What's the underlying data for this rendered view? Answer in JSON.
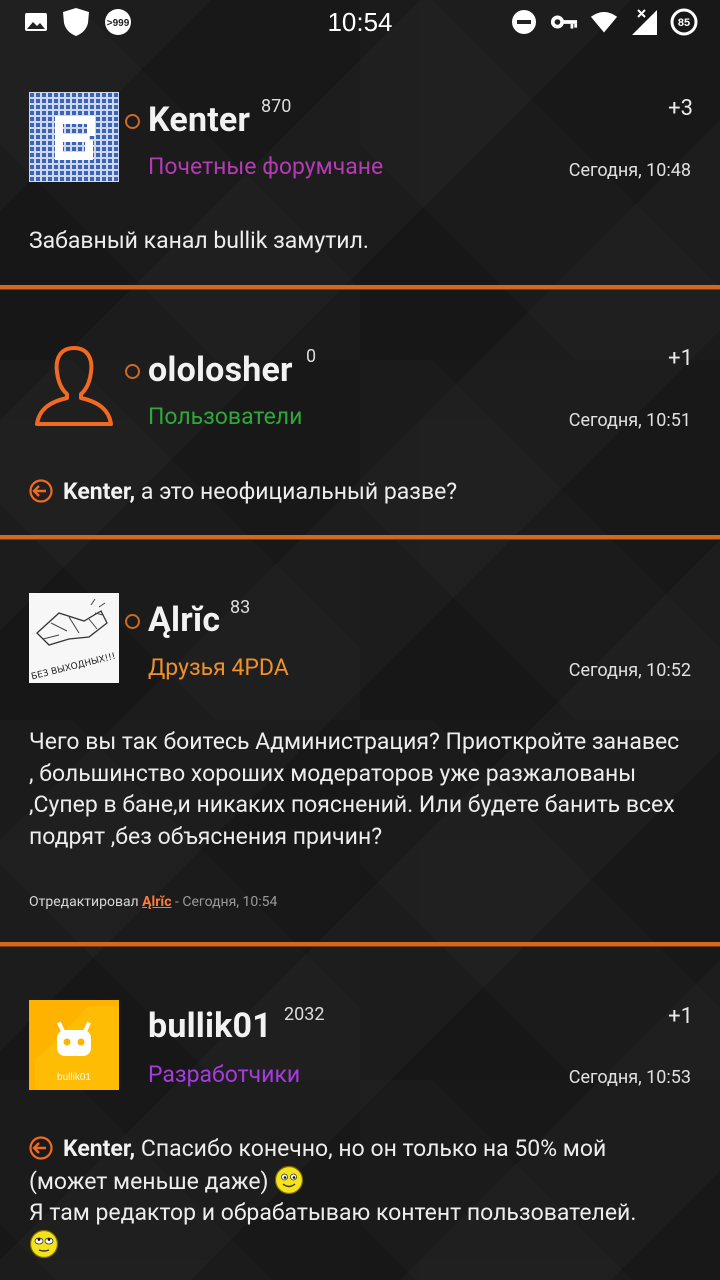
{
  "status_bar": {
    "time": "10:54",
    "notification_badge": ">999",
    "battery": "85",
    "icons": [
      "image-icon",
      "shield-icon",
      "chat-badge-icon",
      "do-not-disturb-icon",
      "key-icon",
      "wifi-icon",
      "signal-icon",
      "battery-icon"
    ]
  },
  "colors": {
    "accent": "#d2691e",
    "group_honored": "#b53bb5",
    "group_users": "#2ea83a",
    "group_friends": "#f0902a",
    "group_developers": "#a63ce0"
  },
  "posts": [
    {
      "nick": "Kenter",
      "rep": "870",
      "group": "Почетные форумчане",
      "vote": "+3",
      "date": "Сегодня, 10:48",
      "text": "Забавный канал bullik замутил."
    },
    {
      "nick": "ololosher",
      "rep": "0",
      "group": "Пользователи",
      "vote": "+1",
      "date": "Сегодня, 10:51",
      "reply_to": "Kenter,",
      "text": "а это неофициальный разве?"
    },
    {
      "nick": "Ąlrĭc",
      "rep": "83",
      "group": "Друзья 4PDA",
      "vote": "",
      "date": "Сегодня, 10:52",
      "avatar_caption": "БЕЗ ВЫХОДНЫХ!!!",
      "text_lines": [
        "Чего вы так боитесь Администрация? Приоткройте занавес",
        ", большинство хороших модераторов уже разжалованы",
        ",Супер в бане,и никаких пояснений. Или будете банить всех",
        "подрят ,без объяснения причин?"
      ],
      "edited_label": "Отредактировал",
      "edited_by": "Ąlrĭc",
      "edited_time": "- Сегодня, 10:54"
    },
    {
      "nick": "bullik01",
      "rep": "2032",
      "group": "Разработчики",
      "vote": "+1",
      "date": "Сегодня, 10:53",
      "avatar_caption": "bullik01",
      "reply_to": "Kenter,",
      "text_line1": "Спасибо конечно, но он только на 50% мой",
      "text_line2": "(может меньше даже)",
      "text_line3": "Я там редактор и обрабатываю контент пользователей."
    }
  ]
}
